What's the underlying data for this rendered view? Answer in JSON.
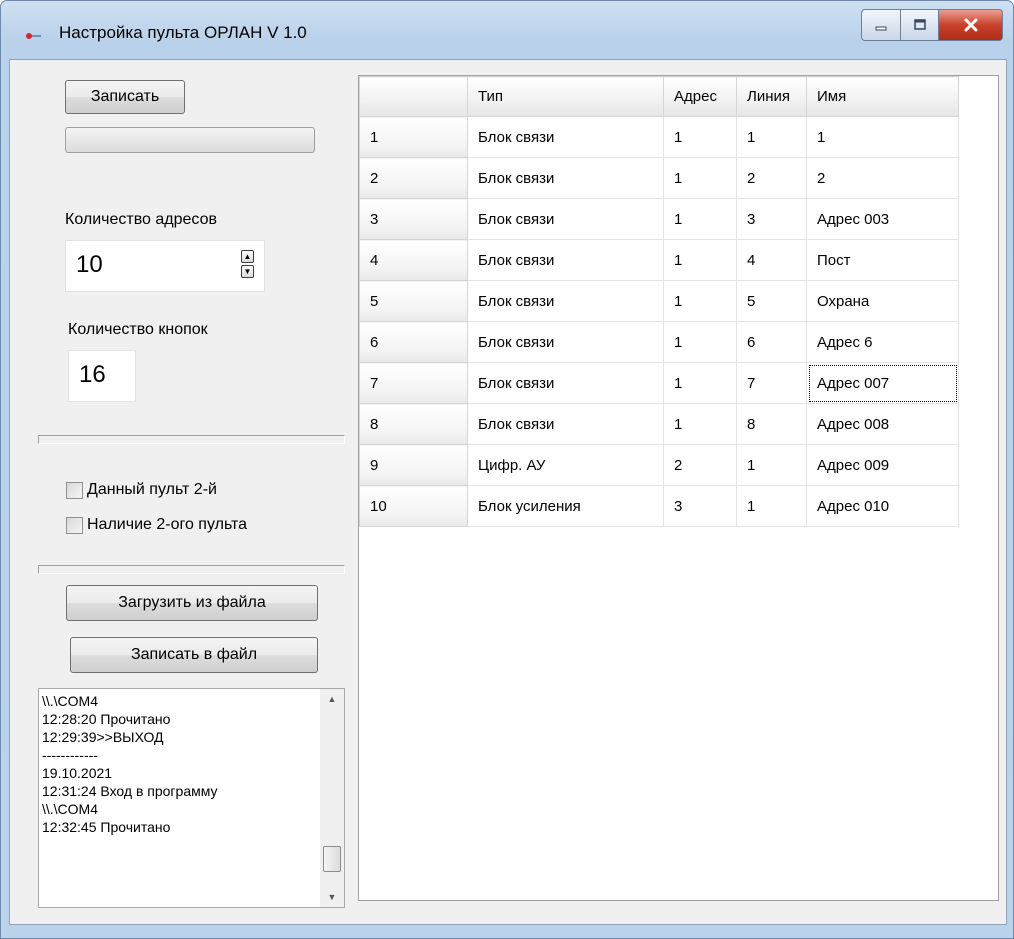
{
  "window": {
    "title": "Настройка пульта ОРЛАН V 1.0",
    "controls": {
      "minimize": "minimize",
      "maximize": "maximize",
      "close": "close"
    }
  },
  "left_panel": {
    "write_button": "Записать",
    "progress": 0,
    "addresses_label": "Количество адресов",
    "addresses_value": "10",
    "buttons_label": "Количество кнопок",
    "buttons_value": "16",
    "checkbox_second_remote": {
      "label": "Данный пульт 2-й",
      "checked": false
    },
    "checkbox_has_second": {
      "label": "Наличие 2-ого пульта",
      "checked": false
    },
    "load_from_file_button": "Загрузить из файла",
    "save_to_file_button": "Записать в файл",
    "log_lines": [
      "\\\\.\\COM4",
      "12:28:20 Прочитано",
      "12:29:39>>ВЫХОД",
      "------------",
      "19.10.2021",
      "12:31:24 Вход в программу",
      "\\\\.\\COM4",
      "12:32:45 Прочитано"
    ]
  },
  "grid": {
    "columns": [
      "",
      "Тип",
      "Адрес",
      "Линия",
      "Имя"
    ],
    "rows": [
      [
        "1",
        "Блок связи",
        "1",
        "1",
        "1"
      ],
      [
        "2",
        "Блок связи",
        "1",
        "2",
        "2"
      ],
      [
        "3",
        "Блок связи",
        "1",
        "3",
        "Адрес 003"
      ],
      [
        "4",
        "Блок связи",
        "1",
        "4",
        "Пост"
      ],
      [
        "5",
        "Блок связи",
        "1",
        "5",
        "Охрана"
      ],
      [
        "6",
        "Блок связи",
        "1",
        "6",
        "Адрес 6"
      ],
      [
        "7",
        "Блок связи",
        "1",
        "7",
        "Адрес 007"
      ],
      [
        "8",
        "Блок связи",
        "1",
        "8",
        "Адрес 008"
      ],
      [
        "9",
        "Цифр. АУ",
        "2",
        "1",
        "Адрес 009"
      ],
      [
        "10",
        "Блок усиления",
        "3",
        "1",
        "Адрес 010"
      ]
    ],
    "focused_cell": [
      6,
      4
    ]
  }
}
